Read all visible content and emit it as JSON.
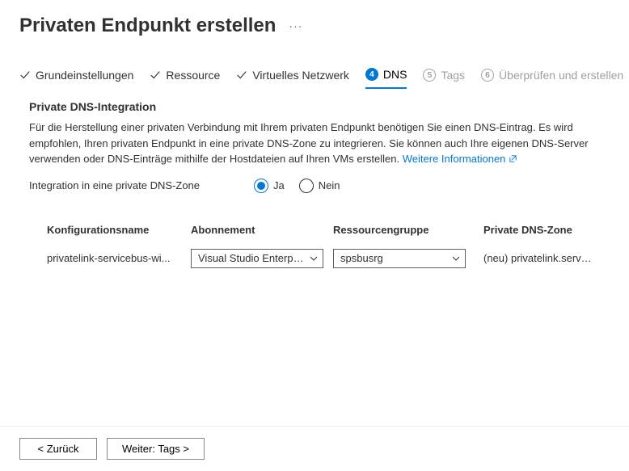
{
  "header": {
    "title": "Privaten Endpunkt erstellen"
  },
  "tabs": {
    "step1": "Grundeinstellungen",
    "step2": "Ressource",
    "step3": "Virtuelles Netzwerk",
    "step4_num": "4",
    "step4": "DNS",
    "step5_num": "5",
    "step5": "Tags",
    "step6_num": "6",
    "step6": "Überprüfen und erstellen"
  },
  "section": {
    "title": "Private DNS-Integration",
    "description": "Für die Herstellung einer privaten Verbindung mit Ihrem privaten Endpunkt benötigen Sie einen DNS-Eintrag. Es wird empfohlen, Ihren privaten Endpunkt in eine private DNS-Zone zu integrieren. Sie können auch Ihre eigenen DNS-Server verwenden oder DNS-Einträge mithilfe der Hostdateien auf Ihren VMs erstellen.",
    "link": "Weitere Informationen"
  },
  "radio": {
    "label": "Integration in eine private DNS-Zone",
    "yes": "Ja",
    "no": "Nein"
  },
  "table": {
    "headers": {
      "name": "Konfigurationsname",
      "subscription": "Abonnement",
      "rg": "Ressourcengruppe",
      "dns": "Private DNS-Zone"
    },
    "row": {
      "name": "privatelink-servicebus-wi...",
      "subscription": "Visual Studio Enterpri...",
      "rg": "spsbusrg",
      "dns": "(neu) privatelink.servicebus..."
    }
  },
  "footer": {
    "back": "<  Zurück",
    "next": "Weiter: Tags  >"
  }
}
